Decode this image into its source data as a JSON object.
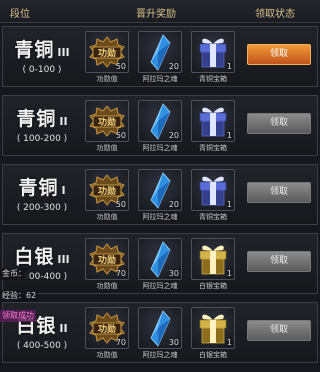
{
  "header": {
    "col_rank": "段位",
    "col_reward": "晋升奖励",
    "col_status": "领取状态"
  },
  "tiers": [
    {
      "name": "青铜",
      "tier": "III",
      "range": "( 0-100 )",
      "rewards": [
        {
          "icon": "merit-badge-icon",
          "qty": "50",
          "label": "功勋值"
        },
        {
          "icon": "blue-crystal-icon",
          "qty": "20",
          "label": "阿拉玛之魂"
        },
        {
          "icon": "blue-gift-box-icon",
          "qty": "1",
          "label": "青铜宝箱"
        }
      ],
      "button": "领取",
      "active": true
    },
    {
      "name": "青铜",
      "tier": "II",
      "range": "( 100-200 )",
      "rewards": [
        {
          "icon": "merit-badge-icon",
          "qty": "50",
          "label": "功勋值"
        },
        {
          "icon": "blue-crystal-icon",
          "qty": "20",
          "label": "阿拉玛之魂"
        },
        {
          "icon": "blue-gift-box-icon",
          "qty": "1",
          "label": "青铜宝箱"
        }
      ],
      "button": "领取",
      "active": false
    },
    {
      "name": "青铜",
      "tier": "I",
      "range": "( 200-300 )",
      "rewards": [
        {
          "icon": "merit-badge-icon",
          "qty": "50",
          "label": "功勋值"
        },
        {
          "icon": "blue-crystal-icon",
          "qty": "20",
          "label": "阿拉玛之魂"
        },
        {
          "icon": "blue-gift-box-icon",
          "qty": "1",
          "label": "青铜宝箱"
        }
      ],
      "button": "领取",
      "active": false
    },
    {
      "name": "白银",
      "tier": "III",
      "range": "( 300-400 )",
      "rewards": [
        {
          "icon": "merit-badge-icon",
          "qty": "70",
          "label": "功勋值"
        },
        {
          "icon": "blue-crystal-icon",
          "qty": "30",
          "label": "阿拉玛之魂"
        },
        {
          "icon": "gold-gift-box-icon",
          "qty": "1",
          "label": "白银宝箱"
        }
      ],
      "button": "领取",
      "active": false
    },
    {
      "name": "白银",
      "tier": "II",
      "range": "( 400-500 )",
      "rewards": [
        {
          "icon": "merit-badge-icon",
          "qty": "70",
          "label": "功勋值"
        },
        {
          "icon": "blue-crystal-icon",
          "qty": "30",
          "label": "阿拉玛之魂"
        },
        {
          "icon": "gold-gift-box-icon",
          "qty": "1",
          "label": "白银宝箱"
        }
      ],
      "button": "领取",
      "active": false
    }
  ],
  "overlay": {
    "line1": "金币：",
    "line2": "经验：62",
    "line3": "领取成功"
  },
  "colors": {
    "accent_button": "#d8742a",
    "header_text": "#d8c38d",
    "gift_blue": "#5a6ed8",
    "gift_gold": "#d4b44a"
  }
}
